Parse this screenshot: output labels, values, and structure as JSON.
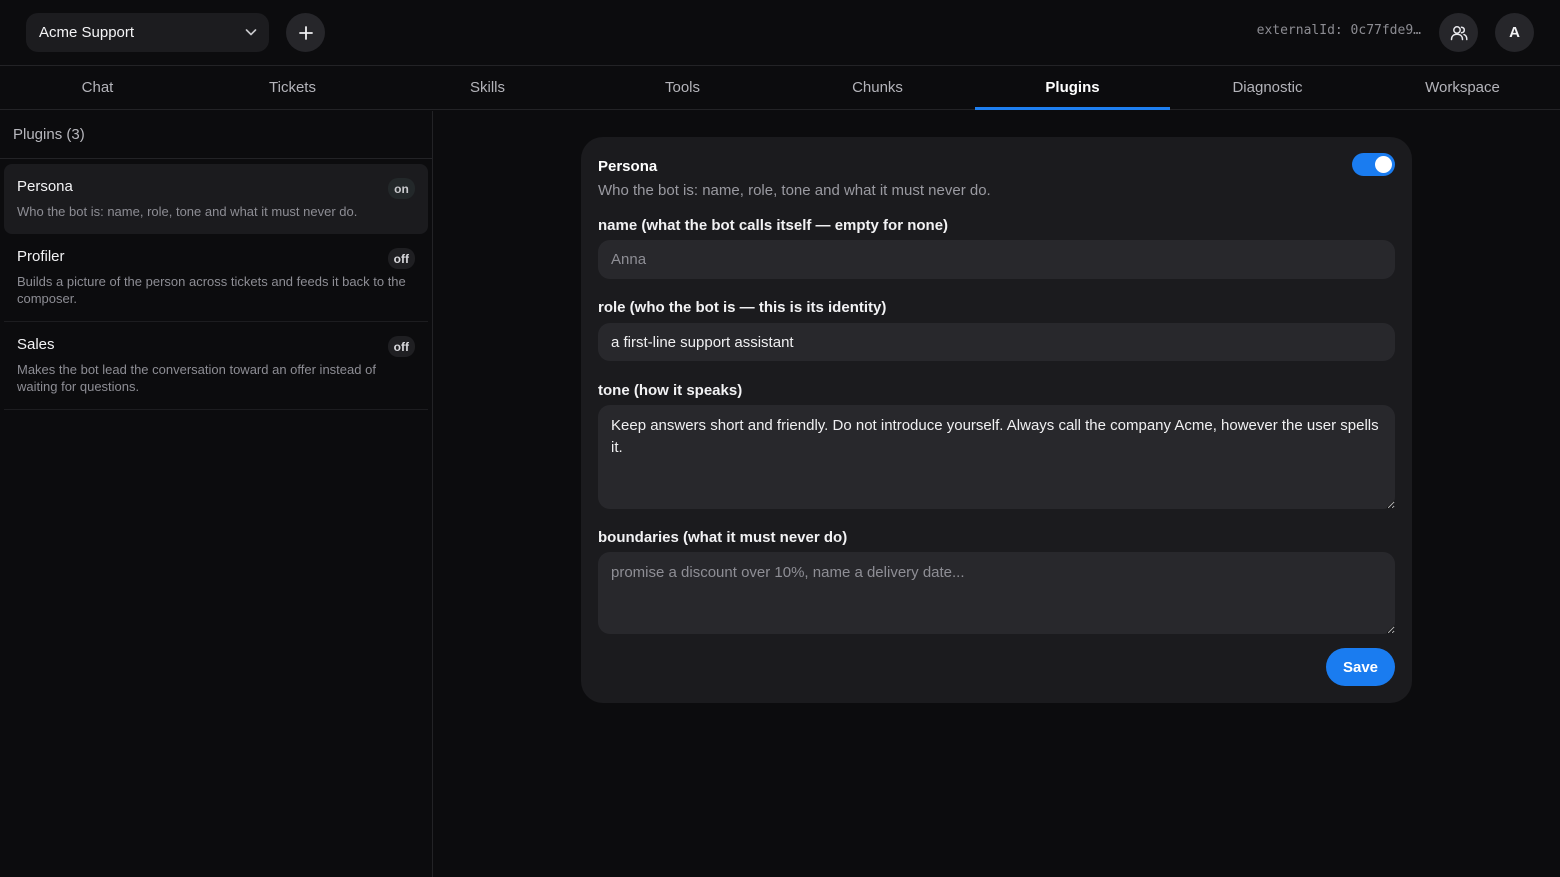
{
  "header": {
    "workspace": "Acme Support",
    "external_id": "externalId: 0c77fde9…",
    "avatar_letter": "A"
  },
  "tabs": [
    {
      "label": "Chat"
    },
    {
      "label": "Tickets"
    },
    {
      "label": "Skills"
    },
    {
      "label": "Tools"
    },
    {
      "label": "Chunks"
    },
    {
      "label": "Plugins",
      "active": true
    },
    {
      "label": "Diagnostic"
    },
    {
      "label": "Workspace"
    }
  ],
  "sidebar": {
    "title": "Plugins (3)",
    "items": [
      {
        "name": "Persona",
        "status": "on",
        "desc": "Who the bot is: name, role, tone and what it must never do."
      },
      {
        "name": "Profiler",
        "status": "off",
        "desc": "Builds a picture of the person across tickets and feeds it back to the composer."
      },
      {
        "name": "Sales",
        "status": "off",
        "desc": "Makes the bot lead the conversation toward an offer instead of waiting for questions."
      }
    ]
  },
  "card": {
    "title": "Persona",
    "subtitle": "Who the bot is: name, role, tone and what it must never do.",
    "enabled": true,
    "fields": {
      "name_label": "name (what the bot calls itself — empty for none)",
      "name_placeholder": "Anna",
      "name_value": "",
      "role_label": "role (who the bot is — this is its identity)",
      "role_value": "a first-line support assistant",
      "tone_label": "tone (how it speaks)",
      "tone_value": "Keep answers short and friendly. Do not introduce yourself. Always call the company Acme, however the user spells it.",
      "boundaries_label": "boundaries (what it must never do)",
      "boundaries_placeholder": "promise a discount over 10%, name a delivery date...",
      "boundaries_value": ""
    },
    "save_label": "Save"
  },
  "colors": {
    "accent": "#1a7cf0",
    "background": "#0c0c0e",
    "card": "#1b1b1e",
    "input": "#28282c"
  }
}
